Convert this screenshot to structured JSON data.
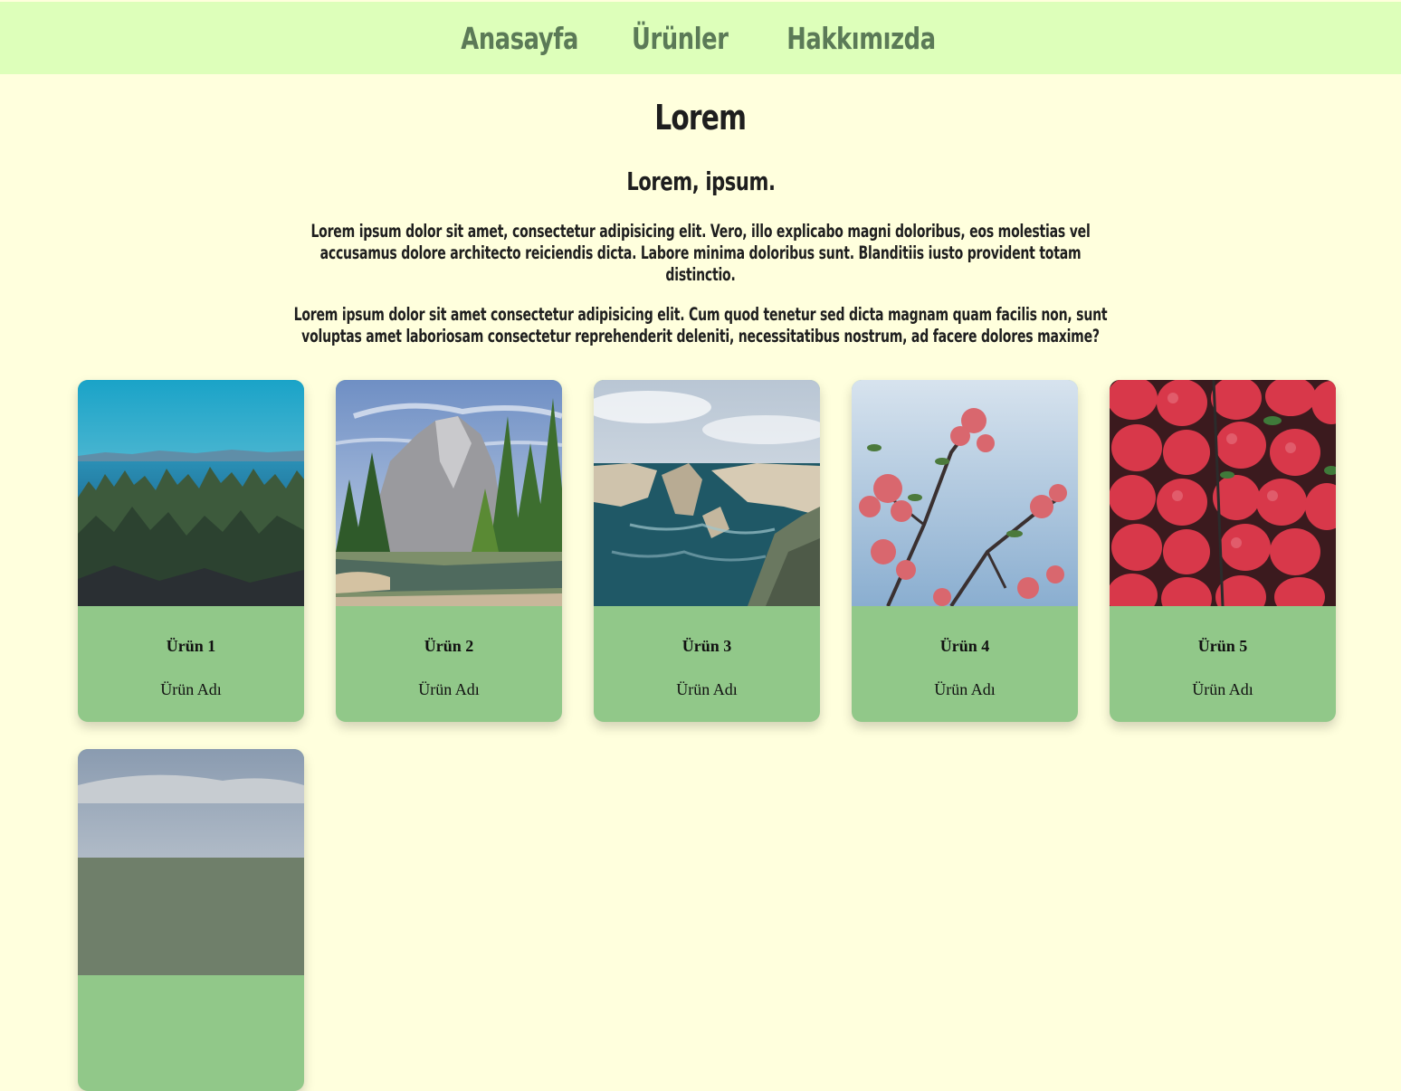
{
  "nav": {
    "items": [
      "Anasayfa",
      "Ürünler",
      "Hakkımızda"
    ]
  },
  "hero": {
    "title": "Lorem",
    "subtitle": "Lorem, ipsum.",
    "paragraph1": "Lorem ipsum dolor sit amet, consectetur adipisicing elit. Vero, illo explicabo magni doloribus, eos molestias vel accusamus dolore architecto reiciendis dicta. Labore minima doloribus sunt. Blanditiis iusto provident totam distinctio.",
    "paragraph2": "Lorem ipsum dolor sit amet consectetur adipisicing elit. Cum quod tenetur sed dicta magnam quam facilis non, sunt voluptas amet laboriosam consectetur reprehenderit deleniti, necessitatibus nostrum, ad facere dolores maxime?"
  },
  "products": [
    {
      "title": "Ürün 1",
      "name": "Ürün Adı",
      "image": "lake-forest-photo"
    },
    {
      "title": "Ürün 2",
      "name": "Ürün Adı",
      "image": "mountain-valley-photo"
    },
    {
      "title": "Ürün 3",
      "name": "Ürün Adı",
      "image": "coastal-cliffs-photo"
    },
    {
      "title": "Ürün 4",
      "name": "Ürün Adı",
      "image": "blossom-branches-photo"
    },
    {
      "title": "Ürün 5",
      "name": "Ürün Adı",
      "image": "strawberries-photo"
    },
    {
      "title": "",
      "name": "",
      "image": "landscape-photo-partial"
    }
  ],
  "colors": {
    "background": "#ffffdd",
    "nav_background": "#ddffba",
    "nav_link": "#5b7a57",
    "card_background": "#91c889"
  }
}
